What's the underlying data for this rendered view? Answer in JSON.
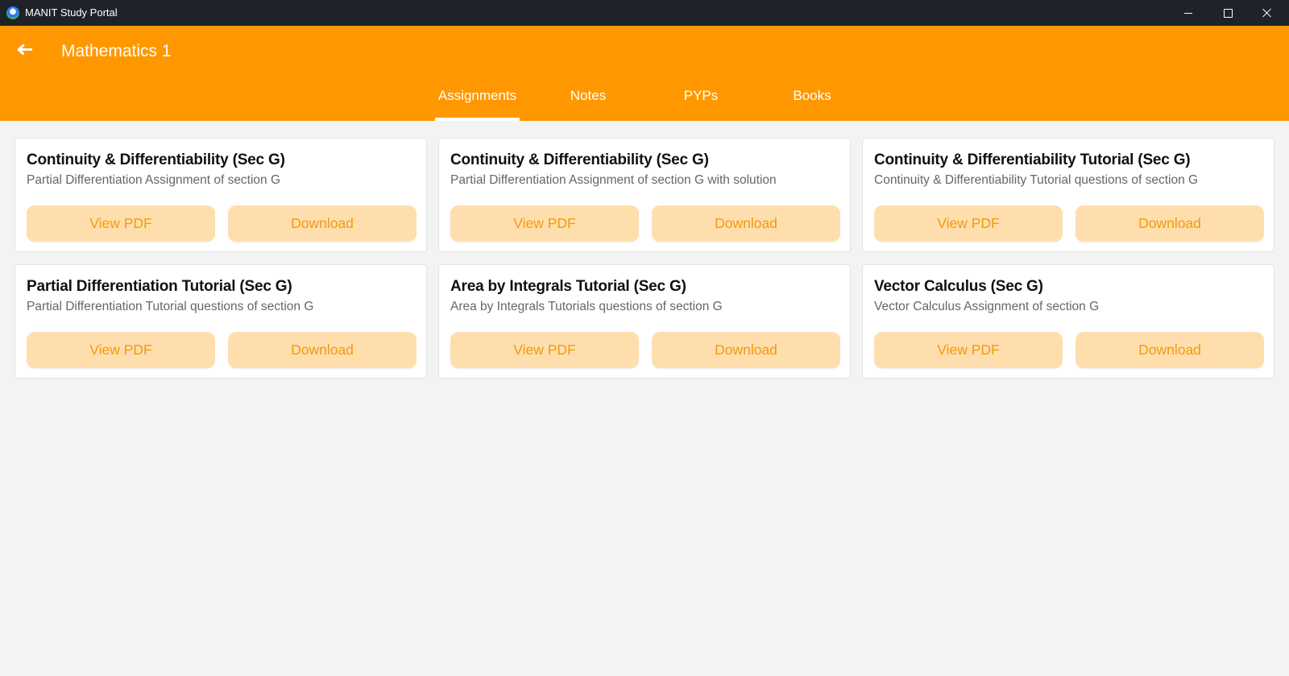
{
  "window": {
    "title": "MANIT Study Portal",
    "icon": "app-globe-icon",
    "controls": [
      "minimize-icon",
      "maximize-icon",
      "close-icon"
    ]
  },
  "header": {
    "back_icon": "arrow-left-icon",
    "title": "Mathematics 1",
    "background_color": "#ff9800"
  },
  "tabs": [
    {
      "label": "Assignments",
      "selected": true
    },
    {
      "label": "Notes",
      "selected": false
    },
    {
      "label": "PYPs",
      "selected": false
    },
    {
      "label": "Books",
      "selected": false
    }
  ],
  "cards": [
    {
      "title": "Continuity & Differentiability (Sec G)",
      "subtitle": "Partial Differentiation Assignment of section G",
      "view_label": "View PDF",
      "download_label": "Download"
    },
    {
      "title": "Continuity & Differentiability (Sec G)",
      "subtitle": "Partial Differentiation Assignment of section G with solution",
      "view_label": "View PDF",
      "download_label": "Download"
    },
    {
      "title": "Continuity & Differentiability Tutorial (Sec G)",
      "subtitle": "Continuity & Differentiability Tutorial questions of section G",
      "view_label": "View PDF",
      "download_label": "Download"
    },
    {
      "title": "Partial Differentiation Tutorial (Sec G)",
      "subtitle": "Partial Differentiation Tutorial questions of section G",
      "view_label": "View PDF",
      "download_label": "Download"
    },
    {
      "title": "Area by Integrals Tutorial (Sec G)",
      "subtitle": "Area by Integrals Tutorials questions of section G",
      "view_label": "View PDF",
      "download_label": "Download"
    },
    {
      "title": "Vector Calculus (Sec G)",
      "subtitle": "Vector Calculus Assignment of section G",
      "view_label": "View PDF",
      "download_label": "Download"
    }
  ],
  "colors": {
    "accent": "#ff9800",
    "button_bg": "#ffdeae",
    "button_text": "#f29b0a",
    "titlebar": "#1f2329",
    "page_bg": "#f3f3f3"
  }
}
